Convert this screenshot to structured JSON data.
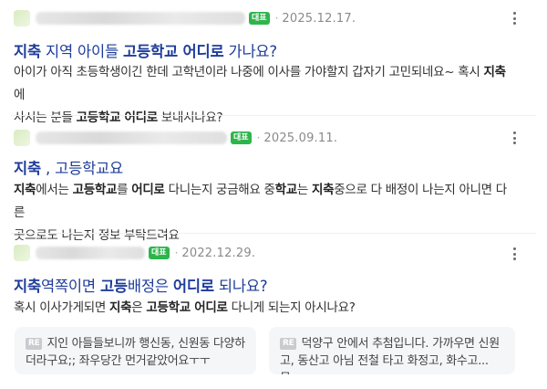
{
  "posts": [
    {
      "badge": "대표",
      "date": "2025.12.17.",
      "title": [
        {
          "text": "지축",
          "bold": true
        },
        {
          "text": " 지역 아이들 ",
          "bold": false
        },
        {
          "text": "고등학교 어디로",
          "bold": true
        },
        {
          "text": " 가나요?",
          "bold": false
        }
      ],
      "snippet_line1": [
        {
          "text": "아이가 아직 초등학생이긴 한데 고학년이라 나중에 이사를 가야할지 갑자기 고민되네요~ 혹시 ",
          "bold": false
        },
        {
          "text": "지축",
          "bold": true
        },
        {
          "text": "에",
          "bold": false
        }
      ],
      "snippet_line2": [
        {
          "text": "사시는 분들 ",
          "bold": false
        },
        {
          "text": "고등학교 어디로",
          "bold": true
        },
        {
          "text": " 보내시나요?",
          "bold": false
        }
      ]
    },
    {
      "badge": "대표",
      "date": "2025.09.11.",
      "title": [
        {
          "text": "지축",
          "bold": true
        },
        {
          "text": " , ",
          "bold": false
        },
        {
          "text": "고등학교요",
          "bold": false
        }
      ],
      "snippet_line1": [
        {
          "text": "지축",
          "bold": true
        },
        {
          "text": "에서는 ",
          "bold": false
        },
        {
          "text": "고등학교",
          "bold": true
        },
        {
          "text": "를 ",
          "bold": false
        },
        {
          "text": "어디로",
          "bold": true
        },
        {
          "text": " 다니는지 궁금해요 중",
          "bold": false
        },
        {
          "text": "학교",
          "bold": true
        },
        {
          "text": "는 ",
          "bold": false
        },
        {
          "text": "지축",
          "bold": true
        },
        {
          "text": "중으로 다 배정이 나는지 아니면 다른",
          "bold": false
        }
      ],
      "snippet_line2": [
        {
          "text": "곳으로도 나는지 정보 부탁드려요",
          "bold": false
        }
      ]
    },
    {
      "badge": "대표",
      "date": "2022.12.29.",
      "title": [
        {
          "text": "지축",
          "bold": true
        },
        {
          "text": "역쪽이면 ",
          "bold": false
        },
        {
          "text": "고등",
          "bold": true
        },
        {
          "text": "배정은 ",
          "bold": false
        },
        {
          "text": "어디로",
          "bold": true
        },
        {
          "text": " 되나요?",
          "bold": false
        }
      ],
      "snippet_line1": [
        {
          "text": "혹시 이사가게되면 ",
          "bold": false
        },
        {
          "text": "지축",
          "bold": true
        },
        {
          "text": "은 ",
          "bold": false
        },
        {
          "text": "고등학교 어디로",
          "bold": true
        },
        {
          "text": " 다니게 되는지 아시나요?",
          "bold": false
        }
      ],
      "snippet_line2": [],
      "replies": [
        {
          "tag": "RE",
          "text": "지인 아들들보니까 행신동, 신원동 다양하더라구요;; 좌우당간 먼거같았어요ㅜㅜ"
        },
        {
          "tag": "RE",
          "text": "덕양구 안에서 추첨입니다. 가까우면 신원고, 동산고 아님 전철 타고 화정고, 화수고...물…"
        }
      ]
    }
  ]
}
